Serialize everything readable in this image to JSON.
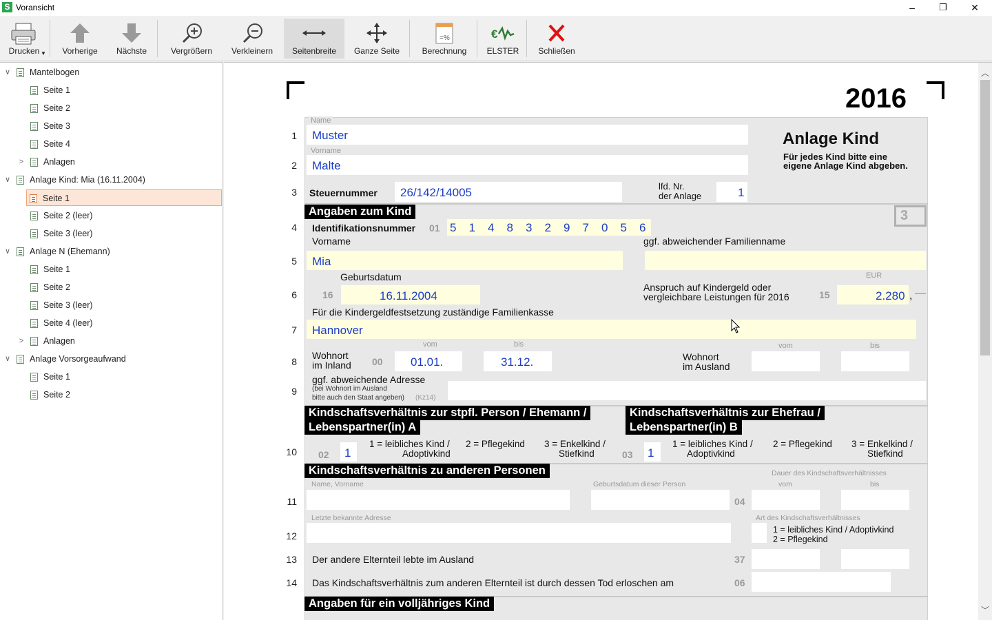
{
  "window": {
    "title": "Voransicht",
    "minimize": "–",
    "maximize": "❐",
    "close": "✕"
  },
  "toolbar": {
    "print": "Drucken",
    "prev": "Vorherige",
    "next": "Nächste",
    "zoom_in": "Vergrößern",
    "zoom_out": "Verkleinern",
    "page_width": "Seitenbreite",
    "whole_page": "Ganze Seite",
    "calc": "Berechnung",
    "elster": "ELSTER",
    "close": "Schließen"
  },
  "tree": [
    {
      "label": "Mantelbogen",
      "level": 0,
      "expander": "∨"
    },
    {
      "label": "Seite 1",
      "level": 1
    },
    {
      "label": "Seite 2",
      "level": 1
    },
    {
      "label": "Seite 3",
      "level": 1
    },
    {
      "label": "Seite 4",
      "level": 1
    },
    {
      "label": "Anlagen",
      "level": 1,
      "expander": ">"
    },
    {
      "label": "Anlage Kind: Mia (16.11.2004)",
      "level": 0,
      "expander": "∨"
    },
    {
      "label": "Seite 1",
      "level": 1,
      "selected": true
    },
    {
      "label": "Seite 2 (leer)",
      "level": 1
    },
    {
      "label": "Seite 3 (leer)",
      "level": 1
    },
    {
      "label": "Anlage N (Ehemann)",
      "level": 0,
      "expander": "∨"
    },
    {
      "label": "Seite 1",
      "level": 1
    },
    {
      "label": "Seite 2",
      "level": 1
    },
    {
      "label": "Seite 3 (leer)",
      "level": 1
    },
    {
      "label": "Seite 4 (leer)",
      "level": 1
    },
    {
      "label": "Anlagen",
      "level": 1,
      "expander": ">"
    },
    {
      "label": "Anlage Vorsorgeaufwand",
      "level": 0,
      "expander": "∨"
    },
    {
      "label": "Seite 1",
      "level": 1
    },
    {
      "label": "Seite 2",
      "level": 1
    }
  ],
  "form": {
    "year": "2016",
    "title": "Anlage Kind",
    "subtitle_1": "Für jedes Kind bitte eine",
    "subtitle_2": "eigene Anlage Kind abgeben.",
    "page_badge": "3",
    "name_label": "Name",
    "name_value": "Muster",
    "vorname_label": "Vorname",
    "vorname_value": "Malte",
    "steuernummer_label": "Steuernummer",
    "steuernummer_value": "26/142/14005",
    "lfd_nr_label_1": "lfd. Nr.",
    "lfd_nr_label_2": "der Anlage",
    "lfd_nr_value": "1",
    "sec_kind": "Angaben zum Kind",
    "idnr_label": "Identifikationsnummer",
    "idnr_code": "01",
    "idnr_digits": [
      "5",
      "1",
      "4",
      "8",
      "3",
      "2",
      "9",
      "7",
      "0",
      "5",
      "6"
    ],
    "kind_vorname_label": "Vorname",
    "kind_vorname_value": "Mia",
    "familienname_label": "ggf. abweichender Familienname",
    "geburtsdatum_label": "Geburtsdatum",
    "geburtsdatum_code": "16",
    "geburtsdatum_value": "16.11.2004",
    "kindergeld_label_1": "Anspruch auf Kindergeld oder",
    "kindergeld_label_2": "vergleichbare Leistungen für 2016",
    "kindergeld_code": "15",
    "eur_label": "EUR",
    "kindergeld_value": "2.280",
    "kindergeld_comma": ",",
    "kindergeld_dash": "—",
    "familienkasse_label": "Für die Kindergeldfestsetzung zuständige Familienkasse",
    "familienkasse_value": "Hannover",
    "vom": "vom",
    "bis": "bis",
    "inland_label_1": "Wohnort",
    "inland_label_2": "im Inland",
    "inland_code": "00",
    "inland_vom": "01.01.",
    "inland_bis": "31.12.",
    "ausland_label_1": "Wohnort",
    "ausland_label_2": "im Ausland",
    "adresse_label": "ggf. abweichende Adresse",
    "adresse_note_1": "(bei Wohnort im  Ausland",
    "adresse_note_2": "bitte auch den Staat angeben)",
    "adresse_note_code": "(Kz14)",
    "sec_a_1": "Kindschaftsverhältnis zur stpfl. Person / Ehemann /",
    "sec_a_2": "Lebenspartner(in) A",
    "sec_b_1": "Kindschaftsverhältnis zur Ehefrau /",
    "sec_b_2": "Lebenspartner(in) B",
    "a_code": "02",
    "a_value": "1",
    "b_code": "03",
    "b_value": "1",
    "opt1_1": "1 = leibliches Kind /",
    "opt1_2": "Adoptivkind",
    "opt2": "2 = Pflegekind",
    "opt3_1": "3 = Enkelkind /",
    "opt3_2": "Stiefkind",
    "sec_andere": "Kindschaftsverhältnis zu anderen Personen",
    "dauer_label": "Dauer des Kindschaftsverhältnisses",
    "name_vorname_label": "Name, Vorname",
    "geb_person_label": "Geburtsdatum dieser Person",
    "andere_code": "04",
    "letzte_adresse_label": "Letzte bekannte Adresse",
    "art_label": "Art des Kindschaftsverhältnisses",
    "art_opt1": "1 = leibliches Kind / Adoptivkind",
    "art_opt2": "2 = Pflegekind",
    "ausland_eltern_label": "Der andere Elternteil lebte im Ausland",
    "ausland_eltern_code": "37",
    "tod_label": "Das Kindschaftsverhältnis zum anderen Elternteil ist durch dessen Tod erloschen am",
    "tod_code": "06",
    "sec_volljaehrig": "Angaben für ein volljähriges Kind",
    "rows": [
      "1",
      "2",
      "3",
      "4",
      "5",
      "6",
      "7",
      "8",
      "9",
      "10",
      "11",
      "12",
      "13",
      "14"
    ]
  }
}
